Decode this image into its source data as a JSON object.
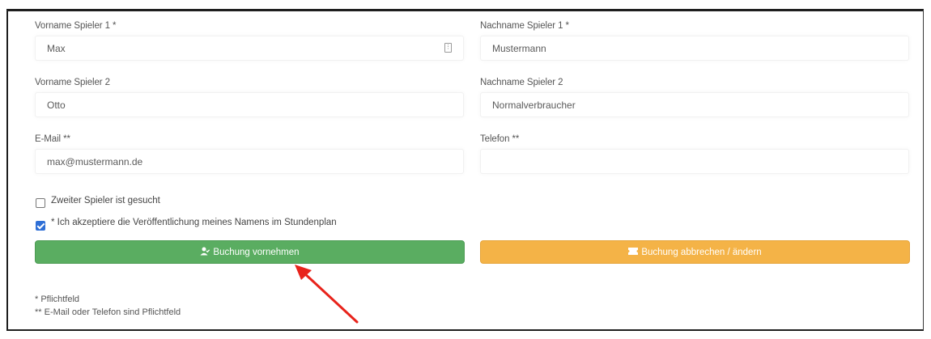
{
  "form": {
    "first_name_1": {
      "label": "Vorname Spieler 1 *",
      "value": "Max"
    },
    "last_name_1": {
      "label": "Nachname Spieler 1 *",
      "value": "Mustermann"
    },
    "first_name_2": {
      "label": "Vorname Spieler 2",
      "value": "Otto"
    },
    "last_name_2": {
      "label": "Nachname Spieler 2",
      "value": "Normalverbraucher"
    },
    "email": {
      "label": "E-Mail **",
      "value": "max@mustermann.de"
    },
    "phone": {
      "label": "Telefon **",
      "value": ""
    },
    "second_player_wanted": {
      "label": "Zweiter Spieler ist gesucht",
      "checked": false
    },
    "accept_publication": {
      "label": "* Ich akzeptiere die Veröffentlichung meines Namens im Stundenplan",
      "checked": true
    }
  },
  "buttons": {
    "book": {
      "label": "Buchung vornehmen",
      "icon": "user-check-icon",
      "color": "#5aad61"
    },
    "cancel": {
      "label": "Buchung abbrechen / ändern",
      "icon": "ticket-icon",
      "color": "#f4b347"
    }
  },
  "footnotes": {
    "required": "* Pflichtfeld",
    "email_or_phone": "** E-Mail oder Telefon sind Pflichtfeld"
  },
  "annotation": {
    "arrow_color": "#e8231b"
  }
}
